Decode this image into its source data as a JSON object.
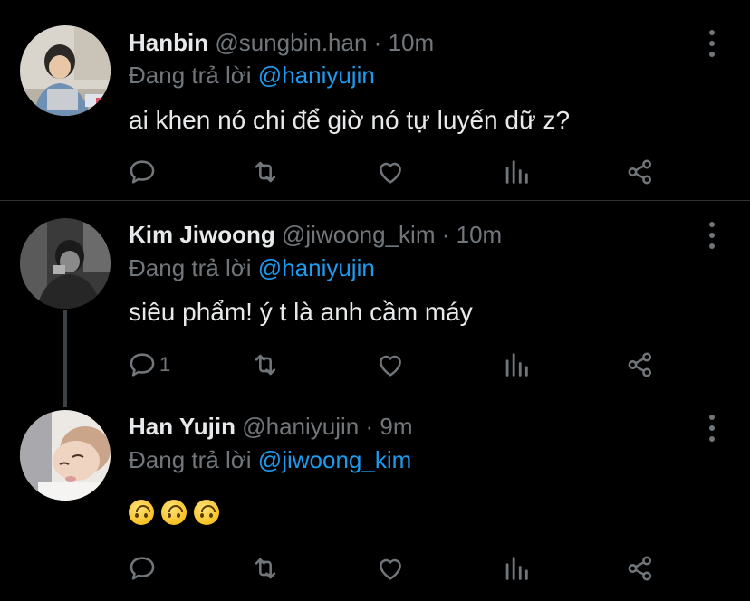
{
  "tweets": [
    {
      "name": "Hanbin",
      "handle": "@sungbin.han",
      "dot": "·",
      "time": "10m",
      "reply_prefix": "Đang trả lời",
      "reply_to": "@haniyujin",
      "text": "ai khen nó chi để giờ nó tự luyến dữ z?",
      "reply_count": ""
    },
    {
      "name": "Kim Jiwoong",
      "handle": "@jiwoong_kim",
      "dot": "·",
      "time": "10m",
      "reply_prefix": "Đang trả lời",
      "reply_to": "@haniyujin",
      "text": "siêu phẩm! ý t là anh cầm máy",
      "reply_count": "1"
    },
    {
      "name": "Han Yujin",
      "handle": "@haniyujin",
      "dot": "·",
      "time": "9m",
      "reply_prefix": "Đang trả lời",
      "reply_to": "@jiwoong_kim",
      "emojis": [
        "🙃",
        "🙃",
        "🙃"
      ],
      "reply_count": ""
    }
  ],
  "icons": {
    "reply": "reply-icon",
    "retweet": "retweet-icon",
    "like": "like-icon",
    "stats": "stats-icon",
    "share": "share-icon",
    "more": "more-options-icon"
  },
  "colors": {
    "background": "#000000",
    "text": "#e7e9ea",
    "muted": "#71767b",
    "mention": "#1d9bf0",
    "divider": "#2f3336"
  }
}
